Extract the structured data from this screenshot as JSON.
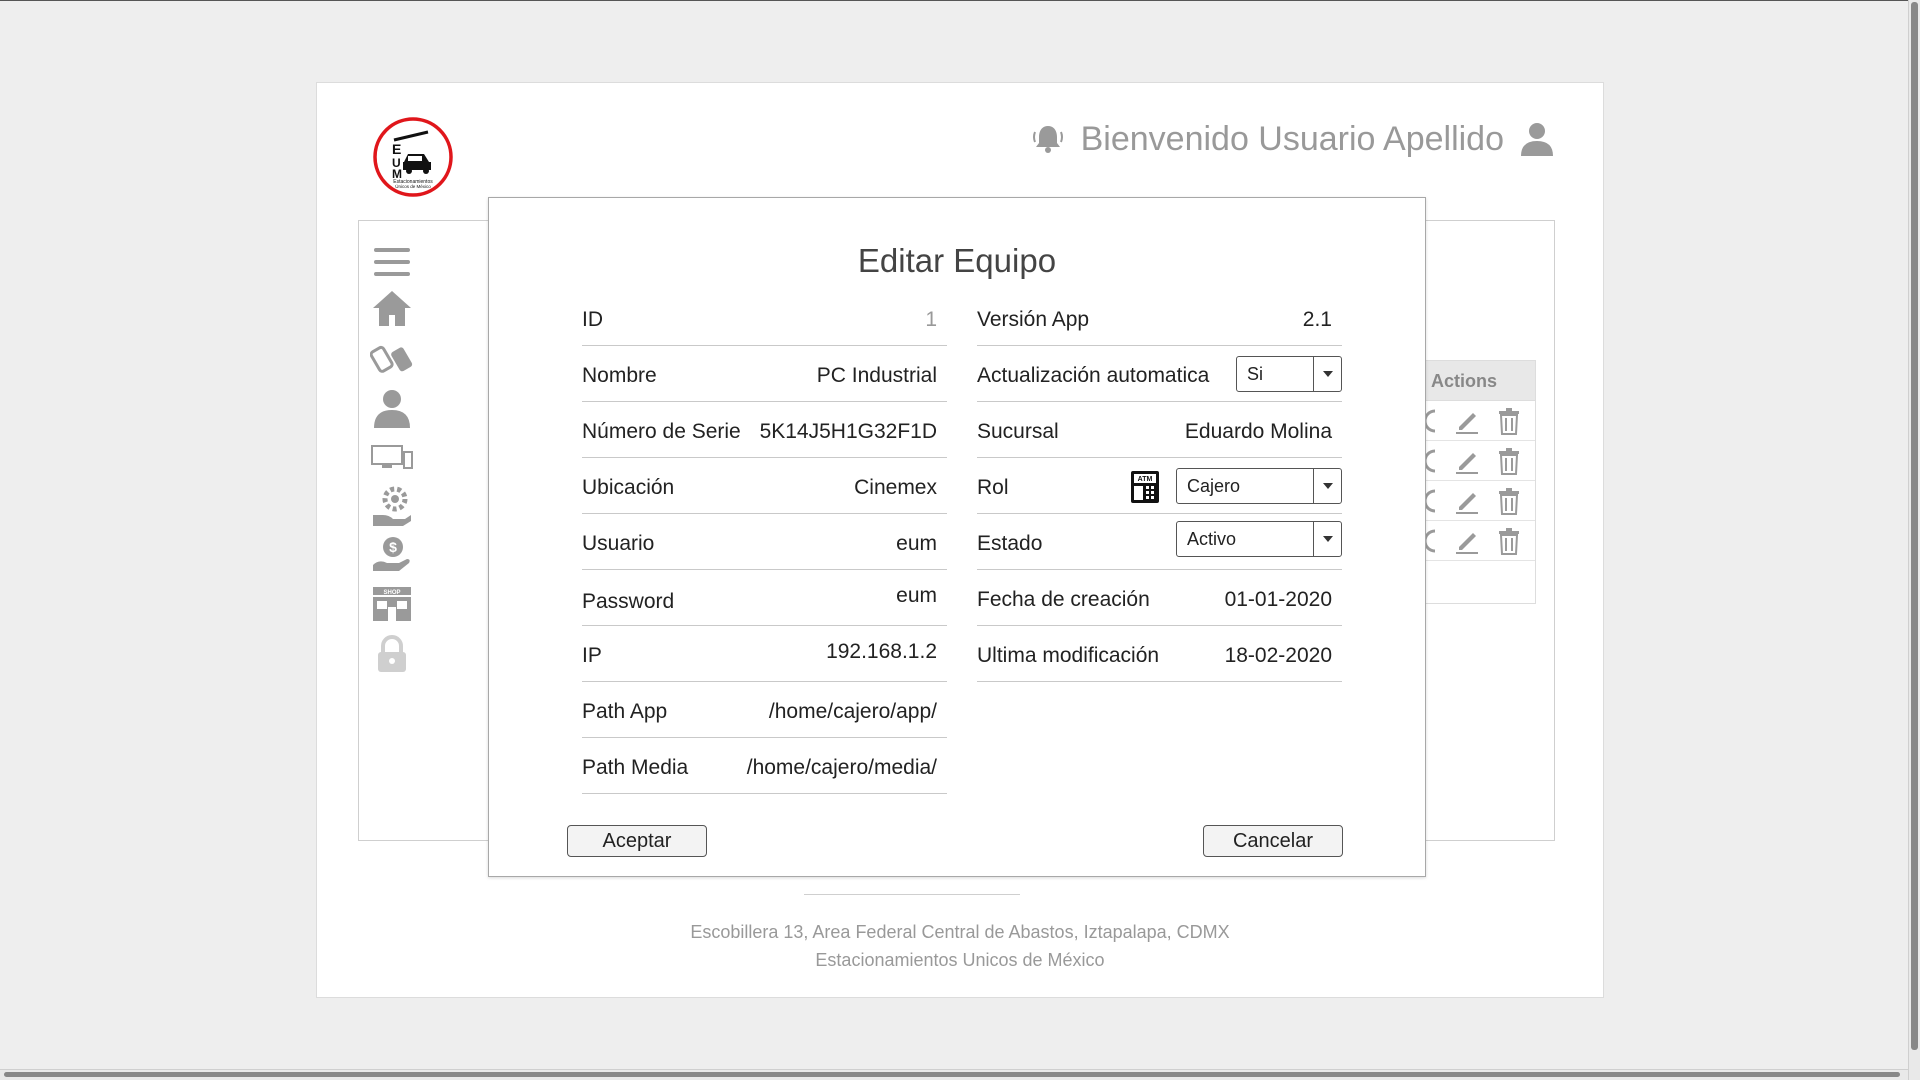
{
  "header": {
    "greeting": "Bienvenido Usuario Apellido"
  },
  "logo": {
    "text_line1": "Estacionamientos",
    "text_line2": "Únicos de México",
    "letters": [
      "E",
      "U",
      "M"
    ]
  },
  "sidebar": {
    "items": [
      {
        "icon": "menu-icon"
      },
      {
        "icon": "home-icon"
      },
      {
        "icon": "tickets-icon"
      },
      {
        "icon": "user-icon"
      },
      {
        "icon": "devices-icon"
      },
      {
        "icon": "settings-hand-icon"
      },
      {
        "icon": "money-hand-icon"
      },
      {
        "icon": "shop-icon",
        "badge": "SHOP"
      },
      {
        "icon": "lock-icon"
      }
    ]
  },
  "background_table": {
    "header": "Actions",
    "rows": 4
  },
  "modal": {
    "title": "Editar Equipo",
    "left_fields": [
      {
        "label": "ID",
        "value": "1"
      },
      {
        "label": "Nombre",
        "value": "PC Industrial"
      },
      {
        "label": "Número de Serie",
        "value": "5K14J5H1G32F1D"
      },
      {
        "label": "Ubicación",
        "value": "Cinemex"
      },
      {
        "label": "Usuario",
        "value": "eum"
      },
      {
        "label": "Password",
        "value": "eum"
      },
      {
        "label": "IP",
        "value": "192.168.1.2"
      },
      {
        "label": "Path App",
        "value": "/home/cajero/app/"
      },
      {
        "label": "Path Media",
        "value": "/home/cajero/media/"
      }
    ],
    "right_fields": {
      "version": {
        "label": "Versión App",
        "value": "2.1"
      },
      "auto_update": {
        "label": "Actualización automatica",
        "value": "Si"
      },
      "sucursal": {
        "label": "Sucursal",
        "value": "Eduardo Molina"
      },
      "rol": {
        "label": "Rol",
        "value": "Cajero",
        "atm_badge": "ATM"
      },
      "estado": {
        "label": "Estado",
        "value": "Activo"
      },
      "created": {
        "label": "Fecha de creación",
        "value": "01-01-2020"
      },
      "modified": {
        "label": "Ultima modificación",
        "value": "18-02-2020"
      }
    },
    "accept_label": "Aceptar",
    "cancel_label": "Cancelar"
  },
  "footer": {
    "address": "Escobillera 13, Area Federal Central de Abastos, Iztapalapa, CDMX",
    "company": "Estacionamientos Unicos de México"
  },
  "colors": {
    "logo_ring": "#e0161b",
    "icon_gray": "#9a9a9a",
    "muted_text": "#999999"
  }
}
